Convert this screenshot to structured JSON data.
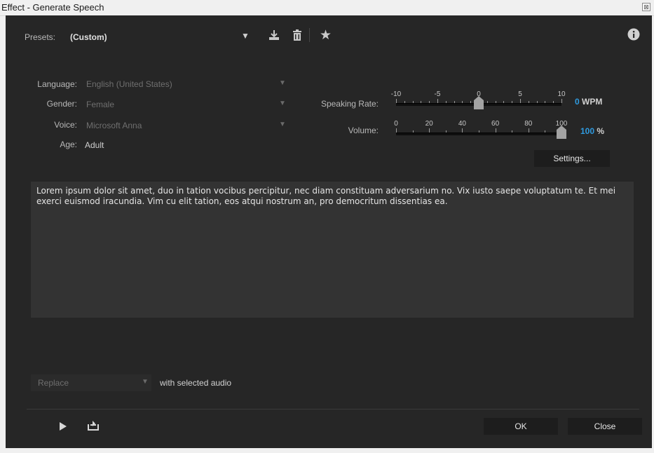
{
  "window": {
    "title": "Effect - Generate Speech",
    "close_glyph": "⊠"
  },
  "presets": {
    "label": "Presets:",
    "value": "(Custom)"
  },
  "toolbar": {
    "save_icon": "save-preset-icon",
    "delete_icon": "trash-icon",
    "favorite_icon": "star-icon",
    "info_icon": "info-icon"
  },
  "fields": {
    "language": {
      "label": "Language:",
      "value": "English (United States)"
    },
    "gender": {
      "label": "Gender:",
      "value": "Female"
    },
    "voice": {
      "label": "Voice:",
      "value": "Microsoft Anna"
    },
    "age": {
      "label": "Age:",
      "value": "Adult"
    }
  },
  "speaking_rate": {
    "label": "Speaking Rate:",
    "ticks": [
      "-10",
      "-5",
      "0",
      "5",
      "10"
    ],
    "value": "0",
    "unit": "WPM",
    "min": -10,
    "max": 10,
    "current": 0
  },
  "volume": {
    "label": "Volume:",
    "ticks": [
      "0",
      "20",
      "40",
      "60",
      "80",
      "100"
    ],
    "value": "100",
    "unit": "%",
    "min": 0,
    "max": 100,
    "current": 100
  },
  "settings_button": "Settings...",
  "text": "Lorem ipsum dolor sit amet, duo in tation vocibus percipitur, nec diam constituam adversarium no. Vix iusto saepe voluptatum te. Et mei exerci euismod iracundia. Vim cu elit tation, eos atqui nostrum an, pro democritum dissentias ea.",
  "mode": {
    "value": "Replace",
    "suffix": "with selected audio"
  },
  "footer": {
    "ok": "OK",
    "close": "Close",
    "play_icon": "play-icon",
    "export_icon": "loop-icon"
  },
  "colors": {
    "accent": "#2f9be0",
    "panel": "#262626",
    "textarea": "#333333"
  }
}
